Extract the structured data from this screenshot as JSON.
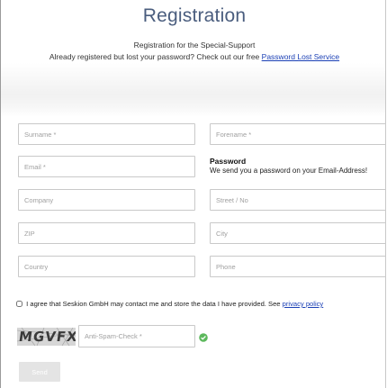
{
  "header": {
    "title": "Registration",
    "subtitle": "Registration for the Special-Support",
    "lost_password_text": "Already registered but lost your password? Check out our free",
    "lost_password_link": "Password Lost Service"
  },
  "form": {
    "surname_placeholder": "Surname *",
    "forename_placeholder": "Forename *",
    "email_placeholder": "Email *",
    "company_placeholder": "Company",
    "street_placeholder": "Street / No",
    "zip_placeholder": "ZIP",
    "city_placeholder": "City",
    "country_placeholder": "Country",
    "phone_placeholder": "Phone"
  },
  "password_note": {
    "title": "Password",
    "text": "We send you a password on your Email-Address!"
  },
  "consent": {
    "checked": false,
    "text": "I agree that Seskion GmbH may contact me and store the data I have provided. See",
    "link": "privacy policy"
  },
  "captcha": {
    "image_text": "MGVFX",
    "placeholder": "Anti-Spam-Check *",
    "status_icon": "check-circle-icon",
    "status_color": "#5cb85c"
  },
  "submit": {
    "label": "Send"
  }
}
